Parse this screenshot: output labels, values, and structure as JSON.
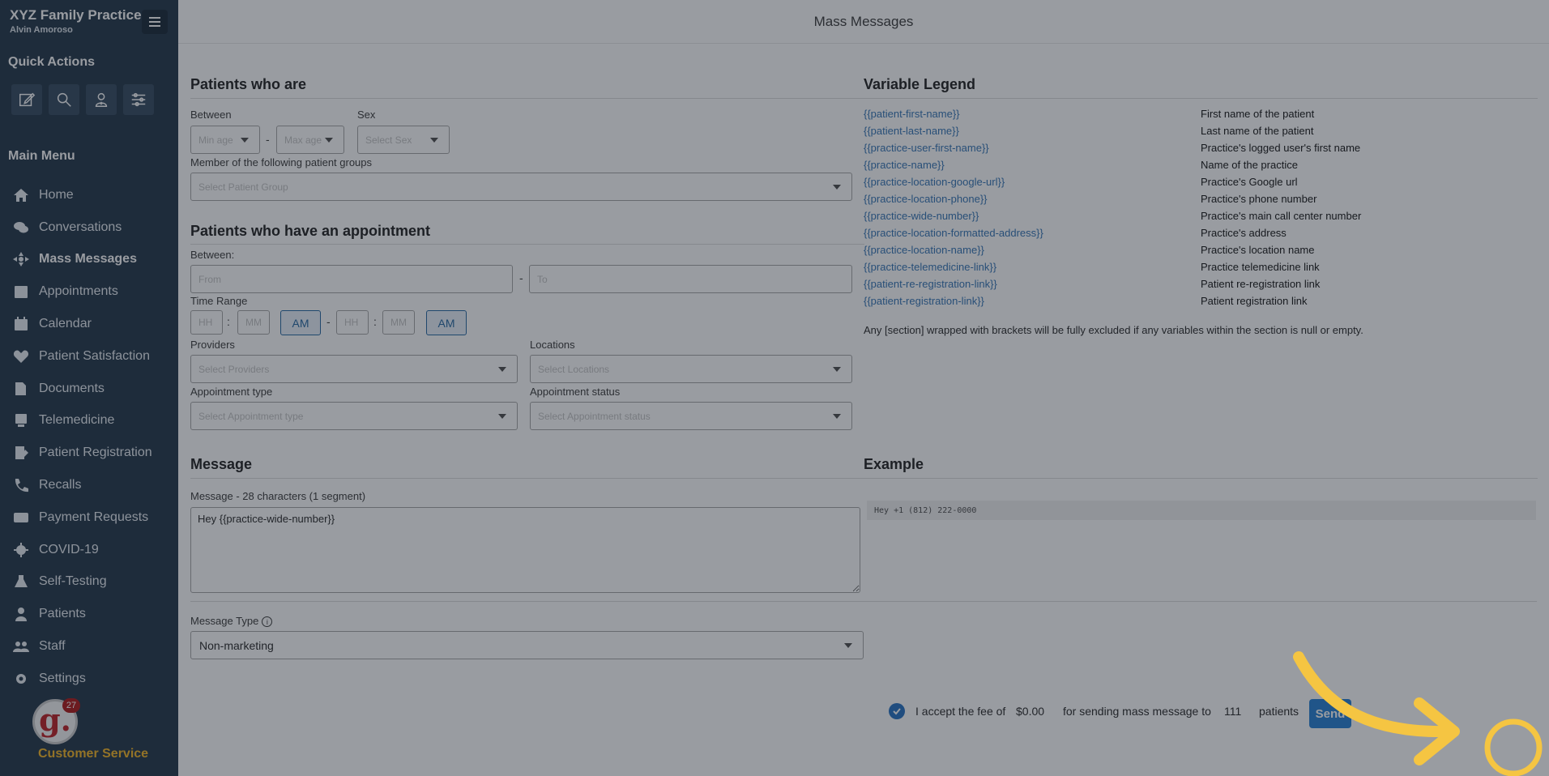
{
  "brand": {
    "name": "XYZ Family Practice",
    "user": "Alvin Amoroso"
  },
  "sidebar": {
    "quick_actions_title": "Quick Actions",
    "quick_actions": [
      {
        "icon": "compose-icon"
      },
      {
        "icon": "search-icon"
      },
      {
        "icon": "patient-add-icon"
      },
      {
        "icon": "sliders-icon"
      }
    ],
    "main_menu_title": "Main Menu",
    "items": [
      {
        "label": "Home",
        "icon": "home-icon"
      },
      {
        "label": "Conversations",
        "icon": "conversations-icon"
      },
      {
        "label": "Mass Messages",
        "icon": "broadcast-icon",
        "active": true
      },
      {
        "label": "Appointments",
        "icon": "appointments-icon"
      },
      {
        "label": "Calendar",
        "icon": "calendar-icon"
      },
      {
        "label": "Patient Satisfaction",
        "icon": "heart-icon"
      },
      {
        "label": "Documents",
        "icon": "documents-icon"
      },
      {
        "label": "Telemedicine",
        "icon": "telemedicine-icon"
      },
      {
        "label": "Patient Registration",
        "icon": "registration-icon"
      },
      {
        "label": "Recalls",
        "icon": "phone-icon"
      },
      {
        "label": "Payment Requests",
        "icon": "credit-card-icon"
      },
      {
        "label": "COVID-19",
        "icon": "virus-icon"
      },
      {
        "label": "Self-Testing",
        "icon": "flask-icon"
      },
      {
        "label": "Patients",
        "icon": "user-icon"
      },
      {
        "label": "Staff",
        "icon": "staff-icon"
      },
      {
        "label": "Settings",
        "icon": "gear-icon"
      }
    ],
    "customer_service": {
      "label": "Customer Service",
      "badge": "27",
      "logo_letter": "g."
    }
  },
  "header": {
    "title": "Mass Messages"
  },
  "patients_who_are": {
    "title": "Patients who are",
    "between_label": "Between",
    "min_age_placeholder": "Min age",
    "max_age_placeholder": "Max age",
    "sex_label": "Sex",
    "sex_placeholder": "Select Sex",
    "groups_label": "Member of the following patient groups",
    "groups_placeholder": "Select Patient Group"
  },
  "appointment": {
    "title": "Patients who have an appointment",
    "between_label": "Between:",
    "from_placeholder": "From",
    "to_placeholder": "To",
    "time_range_label": "Time Range",
    "hh": "HH",
    "mm": "MM",
    "ampm_start": "AM",
    "ampm_end": "AM",
    "providers_label": "Providers",
    "providers_placeholder": "Select Providers",
    "locations_label": "Locations",
    "locations_placeholder": "Select Locations",
    "type_label": "Appointment type",
    "type_placeholder": "Select Appointment type",
    "status_label": "Appointment status",
    "status_placeholder": "Select Appointment status"
  },
  "legend": {
    "title": "Variable Legend",
    "rows": [
      {
        "var": "{{patient-first-name}}",
        "desc": "First name of the patient"
      },
      {
        "var": "{{patient-last-name}}",
        "desc": "Last name of the patient"
      },
      {
        "var": "{{practice-user-first-name}}",
        "desc": "Practice's logged user's first name"
      },
      {
        "var": "{{practice-name}}",
        "desc": "Name of the practice"
      },
      {
        "var": "{{practice-location-google-url}}",
        "desc": "Practice's Google url"
      },
      {
        "var": "{{practice-location-phone}}",
        "desc": "Practice's phone number"
      },
      {
        "var": "{{practice-wide-number}}",
        "desc": "Practice's main call center number"
      },
      {
        "var": "{{practice-location-formatted-address}}",
        "desc": "Practice's address"
      },
      {
        "var": "{{practice-location-name}}",
        "desc": "Practice's location name"
      },
      {
        "var": "{{practice-telemedicine-link}}",
        "desc": "Practice telemedicine link"
      },
      {
        "var": "{{patient-re-registration-link}}",
        "desc": "Patient re-registration link"
      },
      {
        "var": "{{patient-registration-link}}",
        "desc": "Patient registration link"
      }
    ],
    "note": "Any [section] wrapped with brackets will be fully excluded if any variables within the section is null or empty."
  },
  "message": {
    "title": "Message",
    "counter_label": "Message - 28 characters (1 segment)",
    "value": "Hey {{practice-wide-number}}",
    "type_label": "Message Type",
    "type_value": "Non-marketing"
  },
  "example": {
    "title": "Example",
    "text": "Hey +1 (812) 222-0000"
  },
  "footer": {
    "accept_text": "I accept the fee of",
    "fee": "$0.00",
    "sending_text": "for sending mass message to",
    "count": "111",
    "patients_text": "patients",
    "send_label": "Send"
  },
  "colors": {
    "sidebar": "#2c3e50",
    "accent": "#2f86d6",
    "annotation": "#f5c542",
    "link": "#3d7ab8"
  }
}
